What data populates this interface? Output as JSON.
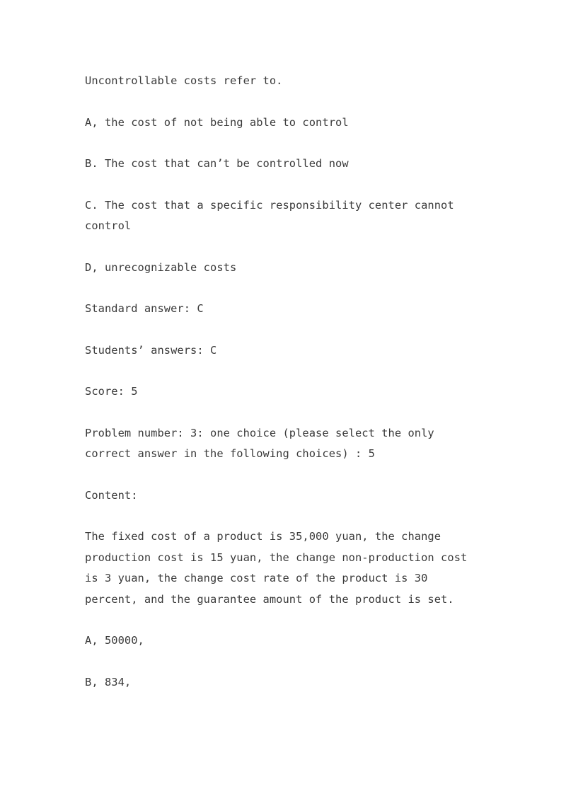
{
  "document": {
    "background_color": "#ffffff",
    "text_color": "#3a3a3a",
    "blocks": [
      {
        "id": "question-stem",
        "text": "Uncontrollable costs refer to."
      },
      {
        "id": "option-a",
        "text": "A, the cost of not being able to control"
      },
      {
        "id": "option-b",
        "text": "B. The cost that can’t be controlled now"
      },
      {
        "id": "option-c",
        "text": "C. The cost that a specific responsibility center cannot control"
      },
      {
        "id": "option-d",
        "text": "D, unrecognizable costs"
      },
      {
        "id": "standard-answer",
        "text": "Standard answer: C"
      },
      {
        "id": "students-answers",
        "text": "Students’ answers: C"
      },
      {
        "id": "score",
        "text": "Score: 5"
      },
      {
        "id": "problem-number",
        "text": "Problem number: 3: one choice (please select the only correct answer in the following choices) : 5"
      },
      {
        "id": "content-label",
        "text": "Content:"
      },
      {
        "id": "problem-content",
        "text": "The fixed cost of a product is 35,000 yuan, the change production cost is 15 yuan, the change non-production cost is 3 yuan, the change cost rate of the product is 30 percent, and the guarantee amount of the product is set."
      },
      {
        "id": "next-option-a",
        "text": "A, 50000,"
      },
      {
        "id": "next-option-b",
        "text": "B, 834,"
      }
    ]
  }
}
